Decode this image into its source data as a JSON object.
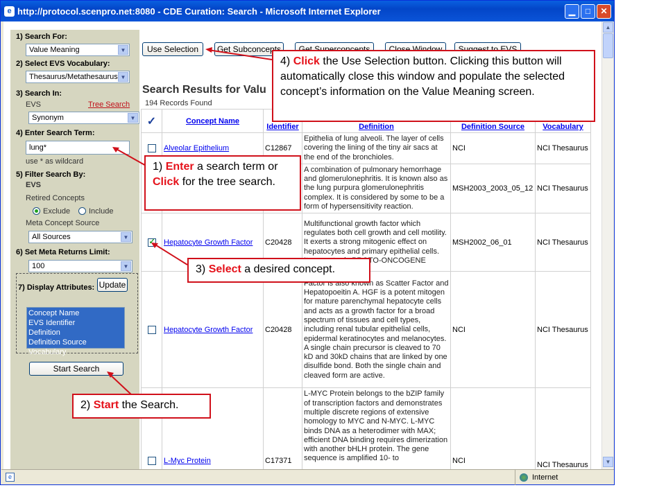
{
  "window": {
    "title": "http://protocol.scenpro.net:8080 - CDE Curation: Search - Microsoft Internet Explorer",
    "status_zone": "Internet"
  },
  "left": {
    "search_for_label": "1) Search For:",
    "search_for_value": "Value Meaning",
    "vocab_label": "2) Select EVS Vocabulary:",
    "vocab_value": "Thesaurus/Metathesaurus",
    "search_in_label": "3) Search In:",
    "evs_label": "EVS",
    "tree_search_link": "Tree Search",
    "search_in_value": "Synonym",
    "term_label": "4) Enter Search Term:",
    "term_value": "lung*",
    "wildcard_hint": "use * as wildcard",
    "filter_label": "5) Filter Search By:",
    "filter_evs": "EVS",
    "retired_label": "Retired Concepts",
    "exclude_label": "Exclude",
    "include_label": "Include",
    "meta_source_label": "Meta Concept Source",
    "meta_source_value": "All Sources",
    "limit_label": "6) Set Meta Returns Limit:",
    "limit_value": "100",
    "display_label": "7) Display Attributes:",
    "update_button": "Update",
    "attributes": [
      "Concept Name",
      "EVS Identifier",
      "Definition",
      "Definition Source",
      "Vocabulary"
    ],
    "start_search_button": "Start Search"
  },
  "toolbar": {
    "use_selection": "Use Selection",
    "get_subconcepts": "Get Subconcepts",
    "get_superconcepts": "Get Superconcepts",
    "close_window": "Close Window",
    "suggest_evs": "Suggest to EVS"
  },
  "results": {
    "title": "Search Results for Valu",
    "records": "194 Records Found",
    "headers": {
      "check": "✓",
      "concept_name": "Concept Name",
      "identifier": "Identifier",
      "definition": "Definition",
      "definition_source": "Definition Source",
      "vocabulary": "Vocabulary"
    },
    "rows": [
      {
        "checked": false,
        "name": "Alveolar Epithelium",
        "id": "C12867",
        "definition": "Epithelia of lung alveoli. The layer of cells covering the lining of the tiny air sacs at the end of the bronchioles.",
        "source": "NCI",
        "vocab": "NCI Thesaurus"
      },
      {
        "checked": false,
        "name": "",
        "id": "",
        "definition": "A combination of pulmonary hemorrhage and glomerulonephritis. It is known also as the lung purpura glomerulonephritis complex. It is considered by some to be a form of hypersensitivity reaction.",
        "source": "MSH2003_2003_05_12",
        "vocab": "NCI Thesaurus"
      },
      {
        "checked": true,
        "name": "Hepatocyte Growth Factor",
        "id": "C20428",
        "definition": "Multifunctional growth factor which regulates both cell growth and cell motility. It exerts a strong mitogenic effect on hepatocytes and primary epithelial cells. Its receptor is PROTO-ONCOGENE",
        "source": "MSH2002_06_01",
        "vocab": "NCI Thesaurus"
      },
      {
        "checked": false,
        "name": "Hepatocyte Growth Factor",
        "id": "C20428",
        "definition": "Factor is also known as Scatter Factor and Hepatopoeitin A. HGF is a potent mitogen for mature parenchymal hepatocyte cells and acts as a growth factor for a broad spectrum of tissues and cell types, including renal tubular epithelial cells, epidermal keratinocytes and melanocytes. A single chain precursor is cleaved to 70 kD and 30kD chains that are linked by one disulfide bond. Both the single chain and cleaved form are active.",
        "source": "NCI",
        "vocab": "NCI Thesaurus"
      },
      {
        "checked": false,
        "name": "L-Myc Protein",
        "id": "C17371",
        "definition": "L-MYC Protein belongs to the bZIP family of transcription factors and demonstrates multiple discrete regions of extensive homology to MYC and N-MYC. L-MYC binds DNA as a heterodimer with MAX; efficient DNA binding requires dimerization with another bHLH protein. The gene sequence is amplified 10- to",
        "source": "NCI",
        "vocab": "NCI Thesaurus"
      }
    ]
  },
  "callouts": {
    "c1_num": "1)",
    "c1_hl1": "Enter",
    "c1_mid": " a search term or ",
    "c1_hl2": "Click",
    "c1_end": " for the tree search.",
    "c2_num": "2)",
    "c2_hl": "Start",
    "c2_end": " the Search.",
    "c3_num": "3)",
    "c3_hl": "Select",
    "c3_end": " a desired concept.",
    "c4_num": "4)",
    "c4_hl": "Click",
    "c4_end": " the Use Selection button. Clicking this button will automatically close this window and populate the selected concept’s information on the Value Meaning screen."
  },
  "colors": {
    "callout_border": "#d0101a",
    "highlight": "#e5111a",
    "titlebar": "#0a54d8",
    "panel": "#d6d6c0"
  }
}
